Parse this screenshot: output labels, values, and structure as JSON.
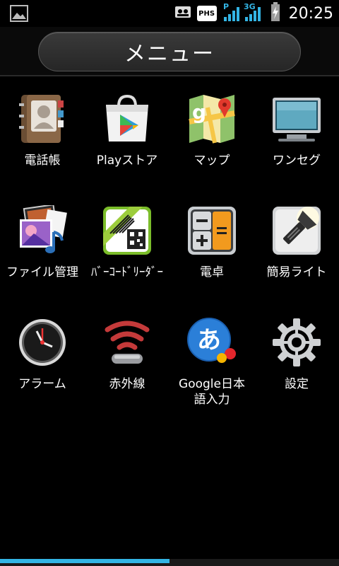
{
  "status_bar": {
    "time": "20:25",
    "phs_label": "PHS",
    "network_label": "3G",
    "signal_label": "P"
  },
  "header": {
    "title": "メニュー"
  },
  "menu": {
    "items": [
      {
        "label": "電話帳",
        "icon": "contacts-icon"
      },
      {
        "label": "Playストア",
        "icon": "play-store-icon"
      },
      {
        "label": "マップ",
        "icon": "maps-icon"
      },
      {
        "label": "ワンセグ",
        "icon": "tv-icon"
      },
      {
        "label": "ファイル管理",
        "icon": "file-manager-icon"
      },
      {
        "label": "ﾊﾞｰｺｰﾄﾞﾘｰﾀﾞｰ",
        "icon": "barcode-reader-icon"
      },
      {
        "label": "電卓",
        "icon": "calculator-icon"
      },
      {
        "label": "簡易ライト",
        "icon": "flashlight-icon"
      },
      {
        "label": "アラーム",
        "icon": "alarm-clock-icon"
      },
      {
        "label": "赤外線",
        "icon": "infrared-icon"
      },
      {
        "label": "Google日本語入力",
        "icon": "google-ime-icon"
      },
      {
        "label": "設定",
        "icon": "settings-gear-icon"
      }
    ]
  },
  "scroll_indicator": {
    "progress": 0.5
  },
  "colors": {
    "accent": "#33b5e5",
    "background": "#000000"
  }
}
